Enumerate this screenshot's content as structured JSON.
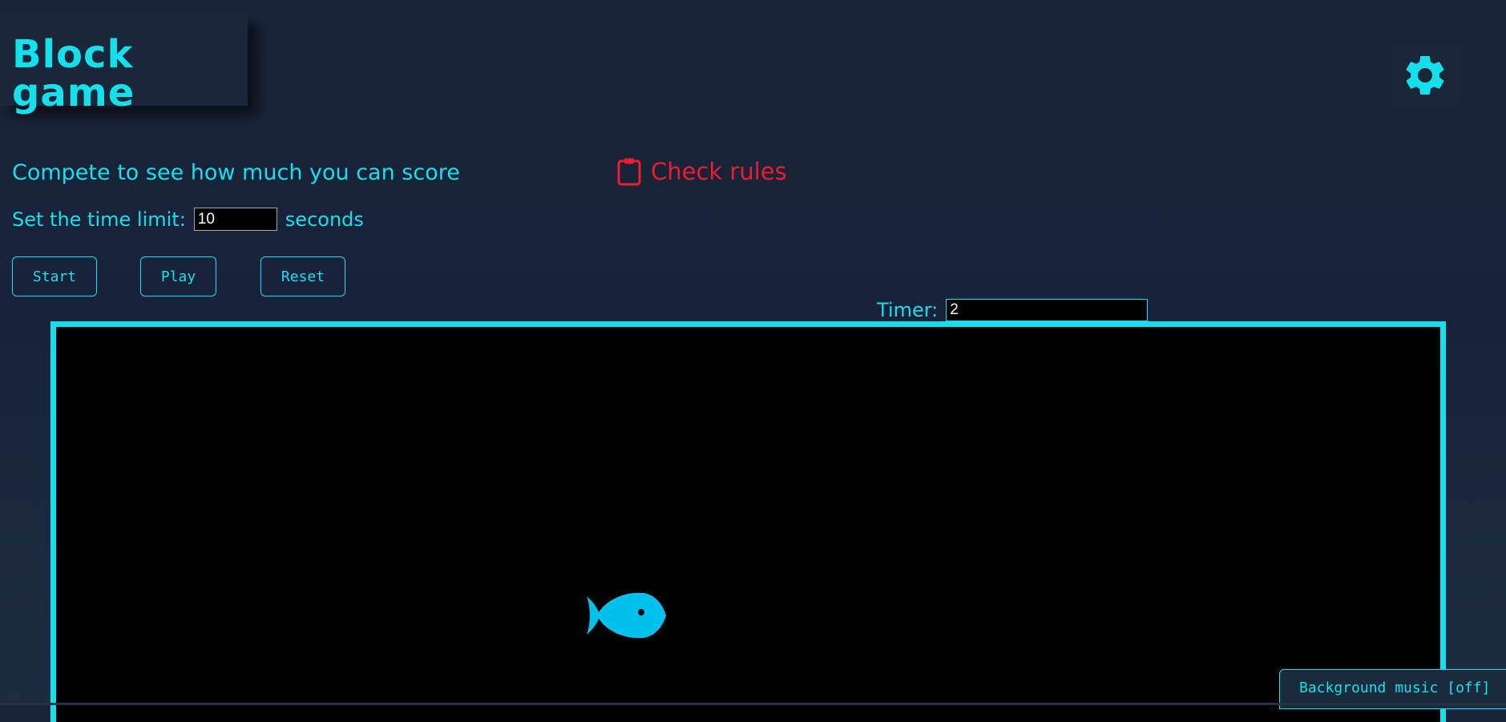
{
  "header": {
    "title": "Block game"
  },
  "settings": {
    "icon": "gear-icon"
  },
  "intro": {
    "tagline": "Compete to see how much you can score",
    "rules_label": "Check rules",
    "rules_icon": "clipboard-icon"
  },
  "time_limit": {
    "label": "Set the time limit:",
    "value": "10",
    "unit": "seconds"
  },
  "controls": {
    "start_label": "Start",
    "play_label": "Play",
    "reset_label": "Reset"
  },
  "timer": {
    "label": "Timer:",
    "value": "2"
  },
  "game": {
    "player_icon": "fish-icon"
  },
  "music": {
    "label": "Background music [off]"
  },
  "colors": {
    "accent": "#12e0ea",
    "rules": "#ef1c2b",
    "fish": "#00c2ec",
    "background": "#1a2438",
    "game_area": "#000000"
  }
}
